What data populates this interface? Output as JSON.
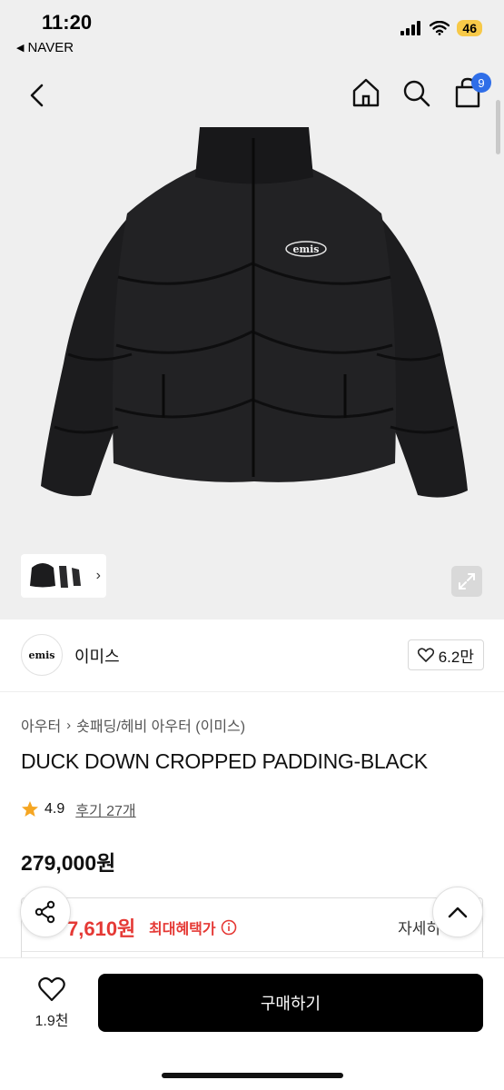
{
  "status_bar": {
    "time": "11:20",
    "back_app": "NAVER",
    "battery": "46"
  },
  "nav": {
    "cart_count": "9"
  },
  "brand": {
    "name": "이미스",
    "logo_text": "emis",
    "likes": "6.2만"
  },
  "breadcrumb": {
    "category": "아우터",
    "subcategory": "숏패딩/헤비 아우터 (이미스)"
  },
  "product": {
    "title": "DUCK DOWN CROPPED PADDING-BLACK",
    "rating": "4.9",
    "reviews": "후기 27개",
    "price": "279,000원"
  },
  "benefit": {
    "price_partial": "7,610원",
    "label": "최대혜택가",
    "detail": "자세히"
  },
  "bottom": {
    "wish_count": "1.9천",
    "buy_label": "구매하기"
  },
  "colors": {
    "accent_red": "#e53935",
    "badge_blue": "#2f6ee8",
    "star": "#f5a623"
  }
}
